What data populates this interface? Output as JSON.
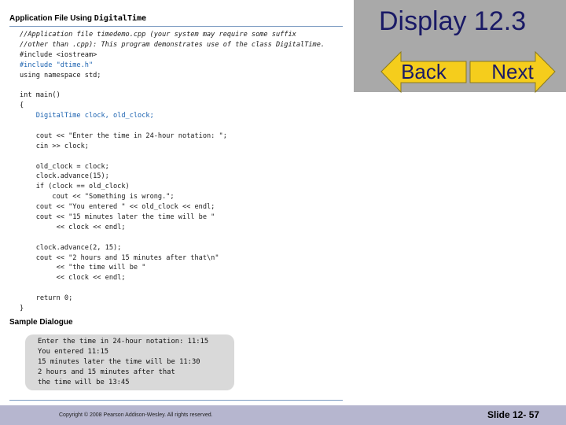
{
  "slide": {
    "title": "Display 12.3",
    "number": "Slide 12- 57"
  },
  "nav": {
    "back_label": "Back",
    "next_label": "Next"
  },
  "colors": {
    "title_block": "#a9a9a9",
    "arrow_fill": "#f5cd1c",
    "title_text": "#1a1a66",
    "footer": "#b6b6cf",
    "code_blue": "#1b62b0",
    "dialog_bg": "#d9d9d9"
  },
  "document": {
    "header_prefix": "Application File Using ",
    "header_class": "DigitalTime",
    "code_lines": [
      "//Application file timedemo.cpp (your system may require some suffix",
      "//other than .cpp): This program demonstrates use of the class DigitalTime.",
      "#include <iostream>",
      "#include \"dtime.h\"",
      "using namespace std;",
      "",
      "int main()",
      "{",
      "    DigitalTime clock, old_clock;",
      "",
      "    cout << \"Enter the time in 24-hour notation: \";",
      "    cin >> clock;",
      "",
      "    old_clock = clock;",
      "    clock.advance(15);",
      "    if (clock == old_clock)",
      "        cout << \"Something is wrong.\";",
      "    cout << \"You entered \" << old_clock << endl;",
      "    cout << \"15 minutes later the time will be \"",
      "         << clock << endl;",
      "",
      "    clock.advance(2, 15);",
      "    cout << \"2 hours and 15 minutes after that\\n\"",
      "         << \"the time will be \"",
      "         << clock << endl;",
      "",
      "    return 0;",
      "}"
    ],
    "sample_label": "Sample Dialogue",
    "dialogue_lines": [
      "Enter the time in 24-hour notation: 11:15",
      "You entered 11:15",
      "15 minutes later the time will be 11:30",
      "2 hours and 15 minutes after that",
      "the time will be 13:45"
    ]
  },
  "footer": {
    "copyright": "Copyright © 2008 Pearson Addison-Wesley. All rights reserved."
  }
}
